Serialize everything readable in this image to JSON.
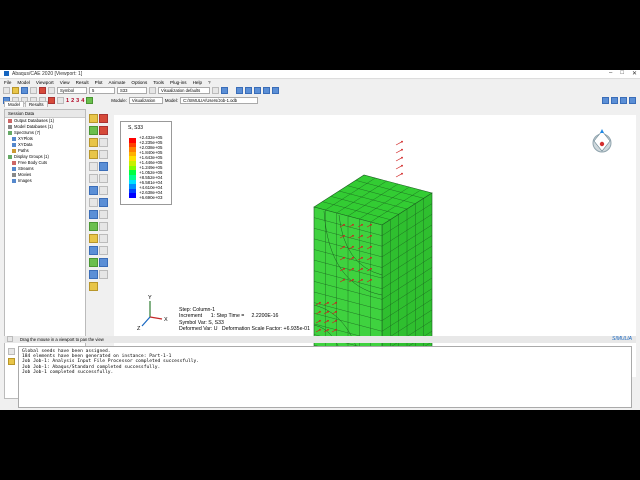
{
  "window": {
    "title": "Abaqus/CAE 2020 [Viewport: 1]",
    "controls": [
      "–",
      "□",
      "✕"
    ]
  },
  "menu": [
    "File",
    "Model",
    "Viewport",
    "View",
    "Result",
    "Plot",
    "Animate",
    "Options",
    "Tools",
    "Plug-ins",
    "Help",
    "?"
  ],
  "toolbar1": {
    "render_style": "Symbol",
    "frame": "5",
    "field": "S33",
    "vis_defaults": "Visualization defaults"
  },
  "toolbar2": {
    "numbers": [
      "1",
      "2",
      "3",
      "4"
    ]
  },
  "context": {
    "module_label": "Module:",
    "module_value": "Visualization",
    "model_label": "Model:",
    "model_value": "C:/SIMULIA/Users/Job-1.odb"
  },
  "tree": {
    "tabs": [
      "Model",
      "Results"
    ],
    "header": "Session Data",
    "items": [
      "Output Databases (1)",
      "Model Databases (1)",
      "Spectrums (7)",
      "XYPlots",
      "XYData",
      "Paths",
      "Display Groups (1)",
      "Free Body Cuts",
      "Streams",
      "Movies",
      "Images"
    ]
  },
  "legend": {
    "variable": "S, S33",
    "values": [
      "+2.432e+05",
      "+2.235e+05",
      "+2.038e+05",
      "+1.840e+05",
      "+1.643e+05",
      "+1.446e+05",
      "+1.249e+05",
      "+1.052e+05",
      "+8.552e+04",
      "+6.581e+04",
      "+4.610e+04",
      "+2.638e+04",
      "+6.690e+03"
    ],
    "colors": [
      "#ff0000",
      "#ff4000",
      "#ff8000",
      "#ffb000",
      "#ffe000",
      "#c8f000",
      "#80ff00",
      "#00ff40",
      "#00ff90",
      "#00e0ff",
      "#0090ff",
      "#0040ff",
      "#0000ff"
    ]
  },
  "viewport_info": {
    "step": "Step: Column-1",
    "increment": "Increment      1: Step Time =     2.2200E-16",
    "symbol_var": "Symbol Var: S, S33",
    "deformed": "Deformed Var: U   Deformation Scale Factor: +6.935e-01"
  },
  "triad": {
    "x": "X",
    "y": "Y",
    "z": "Z"
  },
  "model_color": "#33cc33",
  "arrow_color": "#d02020",
  "prompt": "Drag the mouse in a viewport to pan the view",
  "brand": "SIMULIA",
  "console": [
    "Global seeds have been assigned.",
    "184 elements have been generated on instance: Part-1-1",
    "Job Job-1: Analysis Input File Processor completed successfully.",
    "Job Job-1: Abaqus/Standard completed successfully.",
    "Job Job-1 completed successfully."
  ]
}
